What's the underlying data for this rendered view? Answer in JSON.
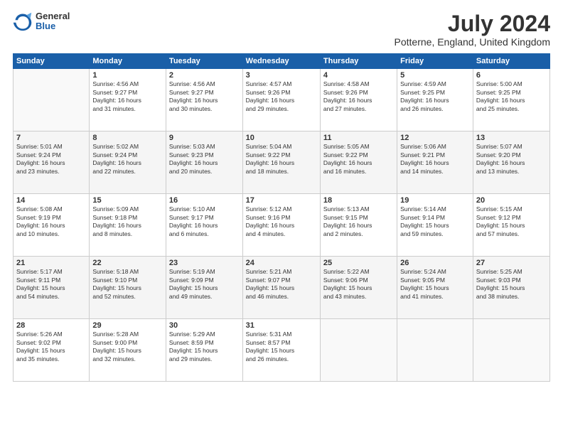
{
  "logo": {
    "general": "General",
    "blue": "Blue"
  },
  "title": "July 2024",
  "subtitle": "Potterne, England, United Kingdom",
  "headers": [
    "Sunday",
    "Monday",
    "Tuesday",
    "Wednesday",
    "Thursday",
    "Friday",
    "Saturday"
  ],
  "weeks": [
    [
      {
        "day": "",
        "info": ""
      },
      {
        "day": "1",
        "info": "Sunrise: 4:56 AM\nSunset: 9:27 PM\nDaylight: 16 hours\nand 31 minutes."
      },
      {
        "day": "2",
        "info": "Sunrise: 4:56 AM\nSunset: 9:27 PM\nDaylight: 16 hours\nand 30 minutes."
      },
      {
        "day": "3",
        "info": "Sunrise: 4:57 AM\nSunset: 9:26 PM\nDaylight: 16 hours\nand 29 minutes."
      },
      {
        "day": "4",
        "info": "Sunrise: 4:58 AM\nSunset: 9:26 PM\nDaylight: 16 hours\nand 27 minutes."
      },
      {
        "day": "5",
        "info": "Sunrise: 4:59 AM\nSunset: 9:25 PM\nDaylight: 16 hours\nand 26 minutes."
      },
      {
        "day": "6",
        "info": "Sunrise: 5:00 AM\nSunset: 9:25 PM\nDaylight: 16 hours\nand 25 minutes."
      }
    ],
    [
      {
        "day": "7",
        "info": "Sunrise: 5:01 AM\nSunset: 9:24 PM\nDaylight: 16 hours\nand 23 minutes."
      },
      {
        "day": "8",
        "info": "Sunrise: 5:02 AM\nSunset: 9:24 PM\nDaylight: 16 hours\nand 22 minutes."
      },
      {
        "day": "9",
        "info": "Sunrise: 5:03 AM\nSunset: 9:23 PM\nDaylight: 16 hours\nand 20 minutes."
      },
      {
        "day": "10",
        "info": "Sunrise: 5:04 AM\nSunset: 9:22 PM\nDaylight: 16 hours\nand 18 minutes."
      },
      {
        "day": "11",
        "info": "Sunrise: 5:05 AM\nSunset: 9:22 PM\nDaylight: 16 hours\nand 16 minutes."
      },
      {
        "day": "12",
        "info": "Sunrise: 5:06 AM\nSunset: 9:21 PM\nDaylight: 16 hours\nand 14 minutes."
      },
      {
        "day": "13",
        "info": "Sunrise: 5:07 AM\nSunset: 9:20 PM\nDaylight: 16 hours\nand 13 minutes."
      }
    ],
    [
      {
        "day": "14",
        "info": "Sunrise: 5:08 AM\nSunset: 9:19 PM\nDaylight: 16 hours\nand 10 minutes."
      },
      {
        "day": "15",
        "info": "Sunrise: 5:09 AM\nSunset: 9:18 PM\nDaylight: 16 hours\nand 8 minutes."
      },
      {
        "day": "16",
        "info": "Sunrise: 5:10 AM\nSunset: 9:17 PM\nDaylight: 16 hours\nand 6 minutes."
      },
      {
        "day": "17",
        "info": "Sunrise: 5:12 AM\nSunset: 9:16 PM\nDaylight: 16 hours\nand 4 minutes."
      },
      {
        "day": "18",
        "info": "Sunrise: 5:13 AM\nSunset: 9:15 PM\nDaylight: 16 hours\nand 2 minutes."
      },
      {
        "day": "19",
        "info": "Sunrise: 5:14 AM\nSunset: 9:14 PM\nDaylight: 15 hours\nand 59 minutes."
      },
      {
        "day": "20",
        "info": "Sunrise: 5:15 AM\nSunset: 9:12 PM\nDaylight: 15 hours\nand 57 minutes."
      }
    ],
    [
      {
        "day": "21",
        "info": "Sunrise: 5:17 AM\nSunset: 9:11 PM\nDaylight: 15 hours\nand 54 minutes."
      },
      {
        "day": "22",
        "info": "Sunrise: 5:18 AM\nSunset: 9:10 PM\nDaylight: 15 hours\nand 52 minutes."
      },
      {
        "day": "23",
        "info": "Sunrise: 5:19 AM\nSunset: 9:09 PM\nDaylight: 15 hours\nand 49 minutes."
      },
      {
        "day": "24",
        "info": "Sunrise: 5:21 AM\nSunset: 9:07 PM\nDaylight: 15 hours\nand 46 minutes."
      },
      {
        "day": "25",
        "info": "Sunrise: 5:22 AM\nSunset: 9:06 PM\nDaylight: 15 hours\nand 43 minutes."
      },
      {
        "day": "26",
        "info": "Sunrise: 5:24 AM\nSunset: 9:05 PM\nDaylight: 15 hours\nand 41 minutes."
      },
      {
        "day": "27",
        "info": "Sunrise: 5:25 AM\nSunset: 9:03 PM\nDaylight: 15 hours\nand 38 minutes."
      }
    ],
    [
      {
        "day": "28",
        "info": "Sunrise: 5:26 AM\nSunset: 9:02 PM\nDaylight: 15 hours\nand 35 minutes."
      },
      {
        "day": "29",
        "info": "Sunrise: 5:28 AM\nSunset: 9:00 PM\nDaylight: 15 hours\nand 32 minutes."
      },
      {
        "day": "30",
        "info": "Sunrise: 5:29 AM\nSunset: 8:59 PM\nDaylight: 15 hours\nand 29 minutes."
      },
      {
        "day": "31",
        "info": "Sunrise: 5:31 AM\nSunset: 8:57 PM\nDaylight: 15 hours\nand 26 minutes."
      },
      {
        "day": "",
        "info": ""
      },
      {
        "day": "",
        "info": ""
      },
      {
        "day": "",
        "info": ""
      }
    ]
  ]
}
